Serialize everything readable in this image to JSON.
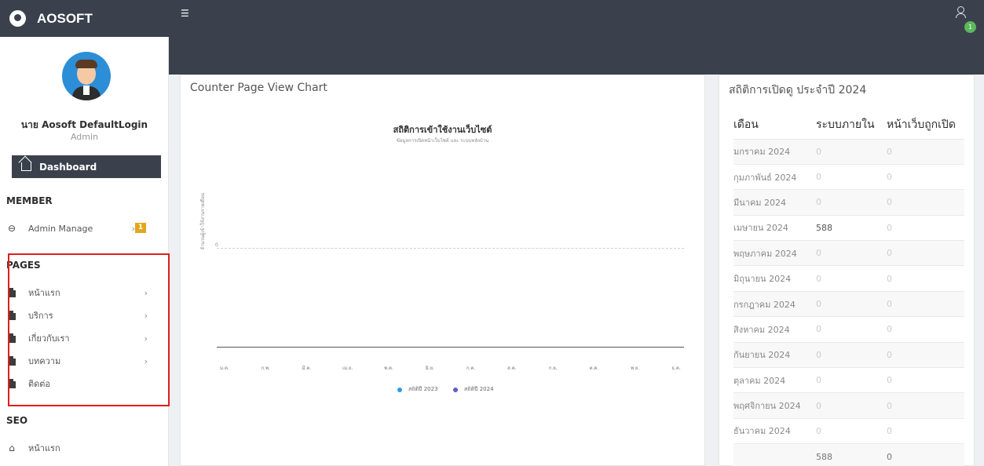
{
  "brand": {
    "title": "AOSOFT"
  },
  "user": {
    "name": "นาย Aosoft DefaultLogin",
    "role": "Admin",
    "notification_count": "1"
  },
  "sidebar": {
    "dashboard": "Dashboard",
    "member_title": "MEMBER",
    "member_items": [
      {
        "label": "Admin Manage",
        "badge": "1"
      }
    ],
    "pages_title": "PAGES",
    "pages_items": [
      {
        "label": "หน้าแรก"
      },
      {
        "label": "บริการ"
      },
      {
        "label": "เกี่ยวกับเรา"
      },
      {
        "label": "บทความ"
      },
      {
        "label": "ติดต่อ"
      }
    ],
    "seo_title": "SEO",
    "seo_items": [
      {
        "label": "หน้าแรก"
      }
    ]
  },
  "chart_panel": {
    "title": "Counter Page View Chart"
  },
  "chart_data": {
    "type": "line",
    "title": "สถิติการเข้าใช้งานเว็บไซต์",
    "subtitle": "ข้อมูลการเปิดหน้าเว็บไซต์ และ ระบบหลังบ้าน",
    "ylabel": "จำนวนผู้เข้าใช้งานรายเดือน",
    "y_tick": "0",
    "categories": [
      "ม.ค.",
      "ก.พ.",
      "มี.ค.",
      "เม.ย.",
      "พ.ค.",
      "มิ.ย.",
      "ก.ค.",
      "ส.ค.",
      "ก.ย.",
      "ต.ค.",
      "พ.ย.",
      "ธ.ค."
    ],
    "series": [
      {
        "name": "สถิติปี 2023",
        "color": "#2e9ae6",
        "values": [
          0,
          0,
          0,
          0,
          0,
          0,
          0,
          0,
          0,
          0,
          0,
          0
        ]
      },
      {
        "name": "สถิติปี 2024",
        "color": "#5b5fc7",
        "values": [
          0,
          0,
          0,
          0,
          0,
          0,
          0,
          0,
          0,
          0,
          0,
          0
        ]
      }
    ]
  },
  "stats_panel": {
    "title": "สถิติการเปิดดู ประจำปี 2024",
    "headers": [
      "เดือน",
      "ระบบภายใน",
      "หน้าเว็บถูกเปิด"
    ],
    "rows": [
      [
        "มกราคม 2024",
        "0",
        "0"
      ],
      [
        "กุมภาพันธ์ 2024",
        "0",
        "0"
      ],
      [
        "มีนาคม 2024",
        "0",
        "0"
      ],
      [
        "เมษายน 2024",
        "588",
        "0"
      ],
      [
        "พฤษภาคม 2024",
        "0",
        "0"
      ],
      [
        "มิถุนายน 2024",
        "0",
        "0"
      ],
      [
        "กรกฎาคม 2024",
        "0",
        "0"
      ],
      [
        "สิงหาคม 2024",
        "0",
        "0"
      ],
      [
        "กันยายน 2024",
        "0",
        "0"
      ],
      [
        "ตุลาคม 2024",
        "0",
        "0"
      ],
      [
        "พฤศจิกายน 2024",
        "0",
        "0"
      ],
      [
        "ธันวาคม 2024",
        "0",
        "0"
      ]
    ],
    "totals": [
      "",
      "588",
      "0"
    ]
  }
}
